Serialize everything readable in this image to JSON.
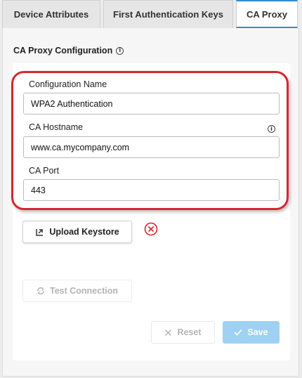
{
  "tabs": [
    {
      "label": "Device Attributes"
    },
    {
      "label": "First Authentication Keys"
    },
    {
      "label": "CA Proxy"
    }
  ],
  "section": {
    "title": "CA Proxy Configuration"
  },
  "fields": {
    "config_name": {
      "label": "Configuration Name",
      "value": "WPA2 Authentication"
    },
    "hostname": {
      "label": "CA Hostname",
      "value": "www.ca.mycompany.com"
    },
    "port": {
      "label": "CA Port",
      "value": "443"
    }
  },
  "buttons": {
    "upload": "Upload Keystore",
    "test": "Test Connection",
    "reset": "Reset",
    "save": "Save"
  },
  "icons": {
    "info": "info-icon",
    "upload": "upload-icon",
    "error": "error-circle-x-icon",
    "test": "refresh-icon",
    "reset": "close-icon",
    "save": "checkmark-icon"
  },
  "colors": {
    "accent": "#2f8bd8",
    "highlight": "#d7262e",
    "error": "#d7262e",
    "save_bg": "#9fd1f2"
  }
}
